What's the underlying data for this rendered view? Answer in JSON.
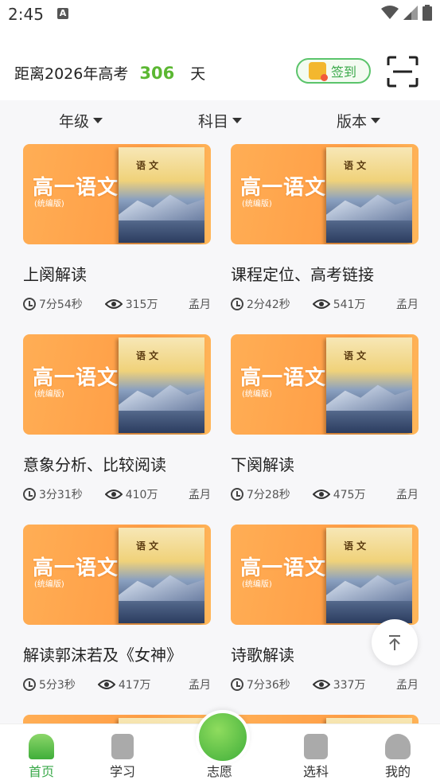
{
  "status_bar": {
    "time": "2:45",
    "notif_letter": "A"
  },
  "header": {
    "countdown_prefix": "距离2026年高考",
    "countdown_days": "306",
    "countdown_suffix": "天",
    "checkin_label": "签到"
  },
  "filters": [
    {
      "label": "年级"
    },
    {
      "label": "科目"
    },
    {
      "label": "版本"
    }
  ],
  "thumb": {
    "big": "高一语文",
    "small": "(统编版)",
    "book_title": "语 文"
  },
  "cards": [
    {
      "title": "上阕解读",
      "duration": "7分54秒",
      "views": "315万",
      "author": "孟月"
    },
    {
      "title": "课程定位、高考链接",
      "duration": "2分42秒",
      "views": "541万",
      "author": "孟月"
    },
    {
      "title": "意象分析、比较阅读",
      "duration": "3分31秒",
      "views": "410万",
      "author": "孟月"
    },
    {
      "title": "下阕解读",
      "duration": "7分28秒",
      "views": "475万",
      "author": "孟月"
    },
    {
      "title": "解读郭沫若及《女神》",
      "duration": "5分3秒",
      "views": "417万",
      "author": "孟月"
    },
    {
      "title": "诗歌解读",
      "duration": "7分36秒",
      "views": "337万",
      "author": "孟月"
    }
  ],
  "bottom_nav": [
    {
      "label": "首页",
      "icon": "home-icon",
      "active": true
    },
    {
      "label": "学习",
      "icon": "book-icon",
      "active": false
    },
    {
      "label": "志愿",
      "icon": "volunteer-icon",
      "active": false
    },
    {
      "label": "选科",
      "icon": "subject-select-icon",
      "active": false
    },
    {
      "label": "我的",
      "icon": "profile-icon",
      "active": false
    }
  ],
  "colors": {
    "accent": "#5bb732",
    "card_orange": "#ff9e46",
    "nav_active": "#3aa94a"
  }
}
